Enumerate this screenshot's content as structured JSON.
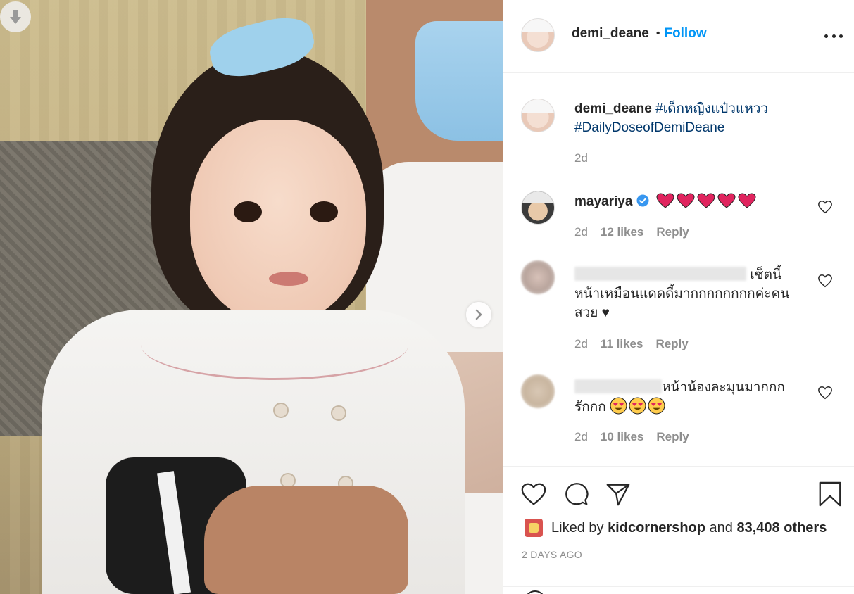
{
  "post": {
    "username": "demi_deane",
    "follow_label": "Follow",
    "dot": "•",
    "caption": {
      "username": "demi_deane",
      "hashtags": [
        "#เด็กหญิงแป๋วแหวว",
        "#DailyDoseofDemiDeane"
      ],
      "time": "2d"
    },
    "comments": [
      {
        "username": "mayariya",
        "verified": true,
        "text_emoji": "red-heart x5",
        "time": "2d",
        "likes": "12 likes",
        "reply": "Reply"
      },
      {
        "username_blurred": true,
        "text_line1": "เซ็ตนี้",
        "text_line2": "หน้าเหมือนแดดดี้มากกกกกกกกค่ะคน",
        "text_line3": "สวย ♥",
        "time": "2d",
        "likes": "11 likes",
        "reply": "Reply"
      },
      {
        "username_blurred": true,
        "username_prefix": "_y_",
        "text_line1": "หน้าน้องละมุนมากกก",
        "text_line2": "รักกก",
        "text_emoji": "heart-eyes x3",
        "time": "2d",
        "likes": "10 likes",
        "reply": "Reply"
      }
    ],
    "liked_by_prefix": "Liked by",
    "liked_by_user": "kidcornershop",
    "liked_by_and": "and",
    "liked_by_others": "83,408 others",
    "time_ago": "2 DAYS AGO"
  },
  "icons": {
    "download": "download-arrow-icon",
    "next": "chevron-right-icon",
    "more": "more-options-icon",
    "like": "heart-icon",
    "comment": "comment-icon",
    "share": "paper-plane-icon",
    "save": "bookmark-icon",
    "verified": "verified-badge-icon"
  },
  "colors": {
    "link": "#0095f6",
    "hashtag": "#00376b",
    "muted": "#8e8e8e",
    "text": "#262626",
    "verified": "#3897f0",
    "heart_emoji": "#e0245e"
  }
}
